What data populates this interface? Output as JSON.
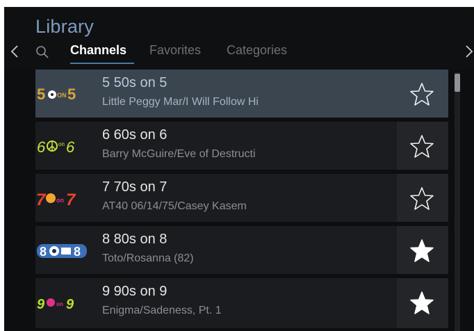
{
  "header": {
    "title": "Library",
    "tabs": [
      {
        "label": "Channels",
        "active": true
      },
      {
        "label": "Favorites",
        "active": false
      },
      {
        "label": "Categories",
        "active": false
      }
    ]
  },
  "channels": [
    {
      "number": "5",
      "title": "5 50s on 5",
      "subtitle": "Little Peggy Mar/I Will Follow Hi",
      "logo_text": "5 on 5",
      "favorite": false,
      "selected": true
    },
    {
      "number": "6",
      "title": "6 60s on 6",
      "subtitle": "Barry McGuire/Eve of Destructi",
      "logo_text": "60s on 6",
      "favorite": false,
      "selected": false
    },
    {
      "number": "7",
      "title": "7 70s on 7",
      "subtitle": "AT40 06/14/75/Casey Kasem",
      "logo_text": "70s on 7",
      "favorite": false,
      "selected": false
    },
    {
      "number": "8",
      "title": "8 80s on 8",
      "subtitle": "Toto/Rosanna (82)",
      "logo_text": "80s on 8",
      "favorite": true,
      "selected": false
    },
    {
      "number": "9",
      "title": "9 90s on 9",
      "subtitle": "Enigma/Sadeness, Pt. 1",
      "logo_text": "90s on 9",
      "favorite": true,
      "selected": false
    }
  ],
  "colors": {
    "accent": "#4b79a6",
    "title": "#7f9bbd",
    "selected_row": "#3a4550",
    "background": "#0d0e10"
  },
  "icons": {
    "nav_left": "chevron-left-icon",
    "nav_right": "chevron-right-icon",
    "search": "search-icon",
    "star_outline": "star-outline-icon",
    "star_filled": "star-filled-icon"
  }
}
